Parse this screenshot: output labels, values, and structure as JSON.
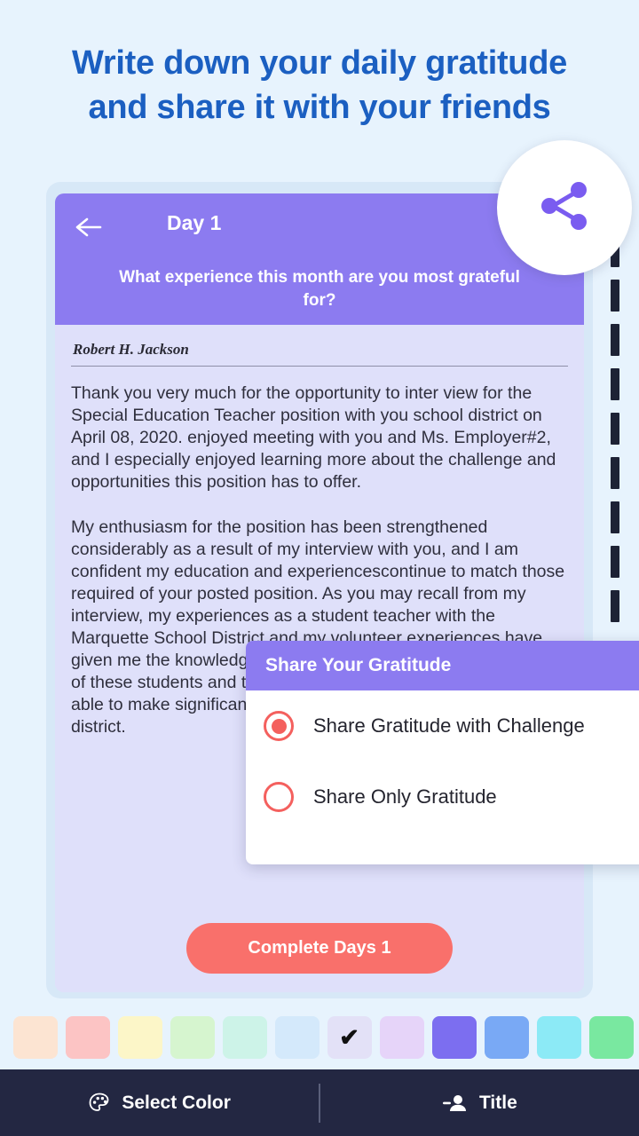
{
  "headline": {
    "line1": "Write down your daily gratitude",
    "line2": "and share it with your friends"
  },
  "card": {
    "back_icon": "back-arrow-icon",
    "day_title": "Day 1",
    "question": "What experience this month are you most grateful for?",
    "signature": "Robert H. Jackson",
    "paragraph1": "Thank you very much for the opportunity to inter view for the Special Education Teacher position with you school district on April 08, 2020. enjoyed meeting with you and Ms. Employer#2, and I especially enjoyed learning more about the challenge and opportunities this position has to offer.",
    "paragraph2": "My enthusiasm for the position has been strengthened considerably as a result of my interview with you, and I am confident my education and experiencescontinue to match those required of your posted position. As you may recall from my interview, my experiences as a student teacher with the Marquette School District and my volunteer experiences have given me the knowledge and skills to meet the growing demands of these students and their families, and I am confident I will be able to make significant contributions to your students and school district.",
    "complete_button": "Complete Days 1"
  },
  "share_fab": {
    "icon": "share-icon"
  },
  "dialog": {
    "title": "Share Your Gratitude",
    "options": [
      {
        "label": "Share Gratitude with Challenge",
        "selected": true
      },
      {
        "label": "Share Only Gratitude",
        "selected": false
      }
    ]
  },
  "palette": {
    "selected_index": 6,
    "check_glyph": "✔",
    "colors": [
      "#fce4d2",
      "#fcc4c4",
      "#fcf6c8",
      "#d6f5cf",
      "#cdf3e8",
      "#d4e9fb",
      "#e3e1f7",
      "#e6d4f9",
      "#7c6ef0",
      "#79a9f5",
      "#8ceaf6",
      "#79e8a0"
    ]
  },
  "bottom_bar": {
    "items": [
      {
        "label": "Select Color",
        "icon": "palette-icon"
      },
      {
        "label": "Title",
        "icon": "person-add-icon"
      }
    ]
  },
  "colors": {
    "headline": "#1b5fc1",
    "header_purple": "#8c7bf0",
    "accent_red": "#f4605e",
    "bottom_bar": "#232742",
    "page_bg": "#e7f3fd"
  }
}
